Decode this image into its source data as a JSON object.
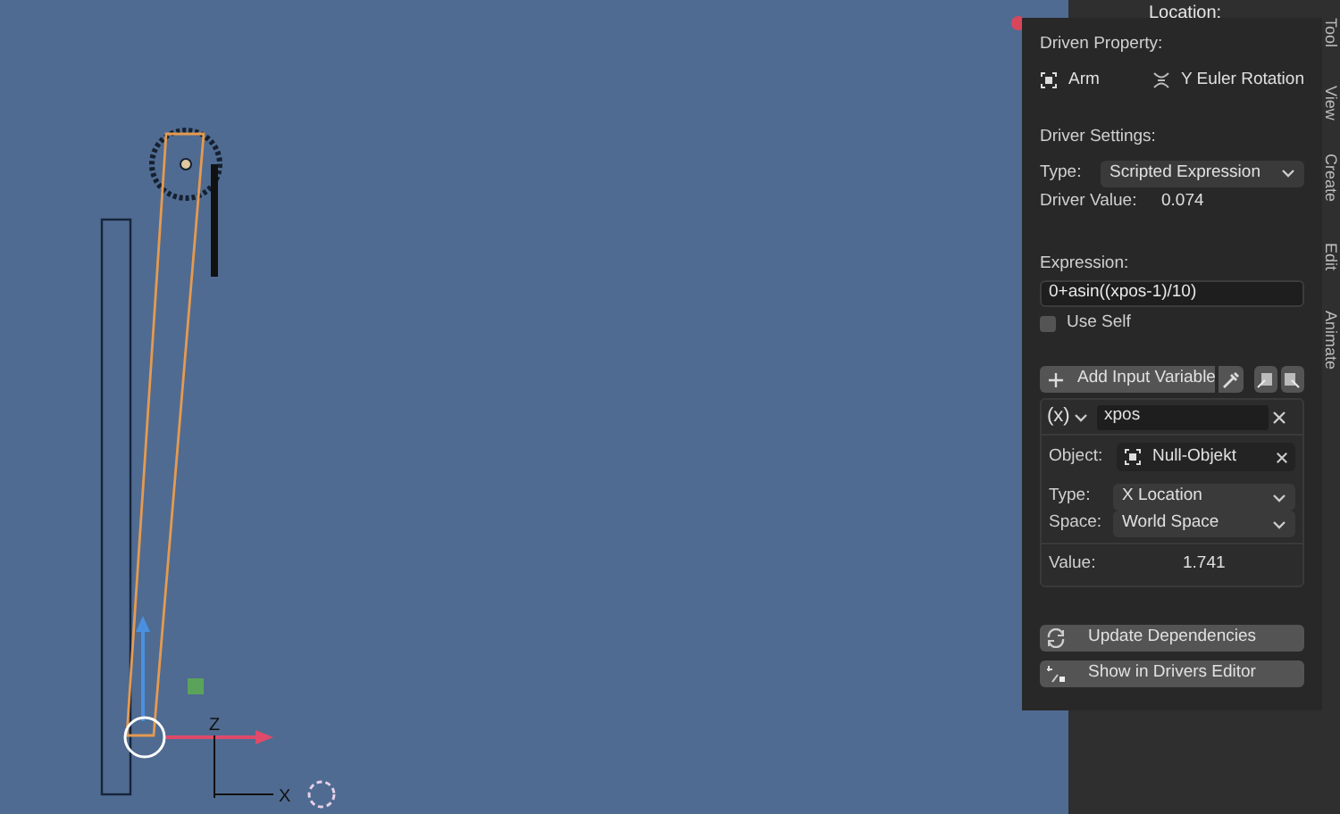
{
  "sidebar": {
    "header": "Location:",
    "tabs": [
      {
        "label": "Tool"
      },
      {
        "label": "View"
      },
      {
        "label": "Create"
      },
      {
        "label": "Edit"
      },
      {
        "label": "Animate"
      }
    ]
  },
  "viewport": {
    "axis_z": "Z",
    "axis_x": "X"
  },
  "driver_popup": {
    "driven_property": {
      "label": "Driven Property:",
      "object": "Arm",
      "property": "Y Euler Rotation"
    },
    "driver_settings": {
      "label": "Driver Settings:",
      "type_label": "Type:",
      "type_value": "Scripted Expression",
      "value_label": "Driver Value:",
      "value": "0.074"
    },
    "expression": {
      "label": "Expression:",
      "value": "0+asin((xpos-1)/10)",
      "use_self": {
        "label": "Use Self",
        "checked": false
      }
    },
    "add_variable": "Add Input Variable",
    "variables": [
      {
        "symbol": "(x)",
        "name": "xpos",
        "object_label": "Object:",
        "object": "Null-Objekt",
        "type_label": "Type:",
        "type": "X Location",
        "space_label": "Space:",
        "space": "World Space",
        "value_label": "Value:",
        "value": "1.741"
      }
    ],
    "buttons": [
      {
        "kind": "refresh",
        "label": "Update Dependencies"
      },
      {
        "kind": "editor",
        "label": "Show in Drivers Editor"
      }
    ]
  }
}
